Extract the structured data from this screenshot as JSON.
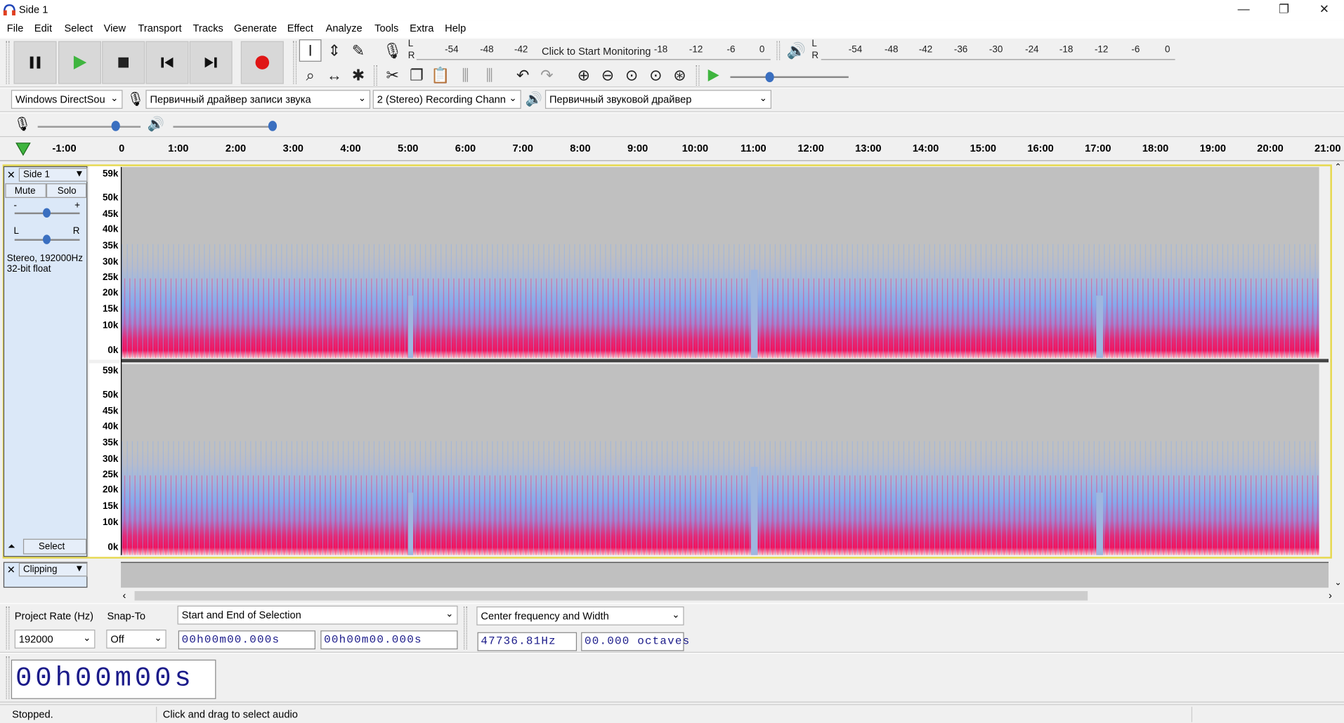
{
  "window": {
    "title": "Side 1",
    "min": "—",
    "max": "❐",
    "close": "✕"
  },
  "menu": [
    "File",
    "Edit",
    "Select",
    "View",
    "Transport",
    "Tracks",
    "Generate",
    "Effect",
    "Analyze",
    "Tools",
    "Extra",
    "Help"
  ],
  "transport": {
    "pause": "pause",
    "play": "play",
    "stop": "stop",
    "skip_start": "skip-to-start",
    "skip_end": "skip-to-end",
    "record": "record"
  },
  "colors": {
    "accent_play": "#3fb53f",
    "record": "#e01616",
    "spec_low": "#f0105c",
    "spec_high": "#86a8ea"
  },
  "meters": {
    "record_hint": "Click to Start Monitoring",
    "rec_ticks": [
      "-54",
      "-48",
      "-42",
      "-18",
      "-12",
      "-6",
      "0"
    ],
    "play_ticks": [
      "-54",
      "-48",
      "-42",
      "-36",
      "-30",
      "-24",
      "-18",
      "-12",
      "-6",
      "0"
    ],
    "lr": [
      "L",
      "R"
    ]
  },
  "devices": {
    "host": "Windows DirectSou",
    "rec_device": "Первичный драйвер записи звука",
    "channels": "2 (Stereo) Recording Chann",
    "play_device": "Первичный звуковой драйвер"
  },
  "ruler": {
    "ticks": [
      "-1:00",
      "0",
      "1:00",
      "2:00",
      "3:00",
      "4:00",
      "5:00",
      "6:00",
      "7:00",
      "8:00",
      "9:00",
      "10:00",
      "11:00",
      "12:00",
      "13:00",
      "14:00",
      "15:00",
      "16:00",
      "17:00",
      "18:00",
      "19:00",
      "20:00",
      "21:00"
    ]
  },
  "track": {
    "name": "Side 1",
    "mute": "Mute",
    "solo": "Solo",
    "gain_minus": "-",
    "gain_plus": "+",
    "pan_l": "L",
    "pan_r": "R",
    "info1": "Stereo, 192000Hz",
    "info2": "32-bit float",
    "select": "Select",
    "freq_labels": [
      "59k",
      "50k",
      "45k",
      "40k",
      "35k",
      "30k",
      "25k",
      "20k",
      "15k",
      "10k",
      "0k"
    ]
  },
  "track2": {
    "name": "Clipping"
  },
  "selection": {
    "project_rate_label": "Project Rate (Hz)",
    "snap_label": "Snap-To",
    "rate": "192000",
    "snap": "Off",
    "format": "Start and End of Selection",
    "start": "00h00m00.000s",
    "end": "00h00m00.000s",
    "spectral_format": "Center frequency and Width",
    "center": "47736.81Hz",
    "width": "00.000 octaves"
  },
  "time": {
    "display": "00h00m00s"
  },
  "status": {
    "state": "Stopped.",
    "hint": "Click and drag to select audio"
  }
}
